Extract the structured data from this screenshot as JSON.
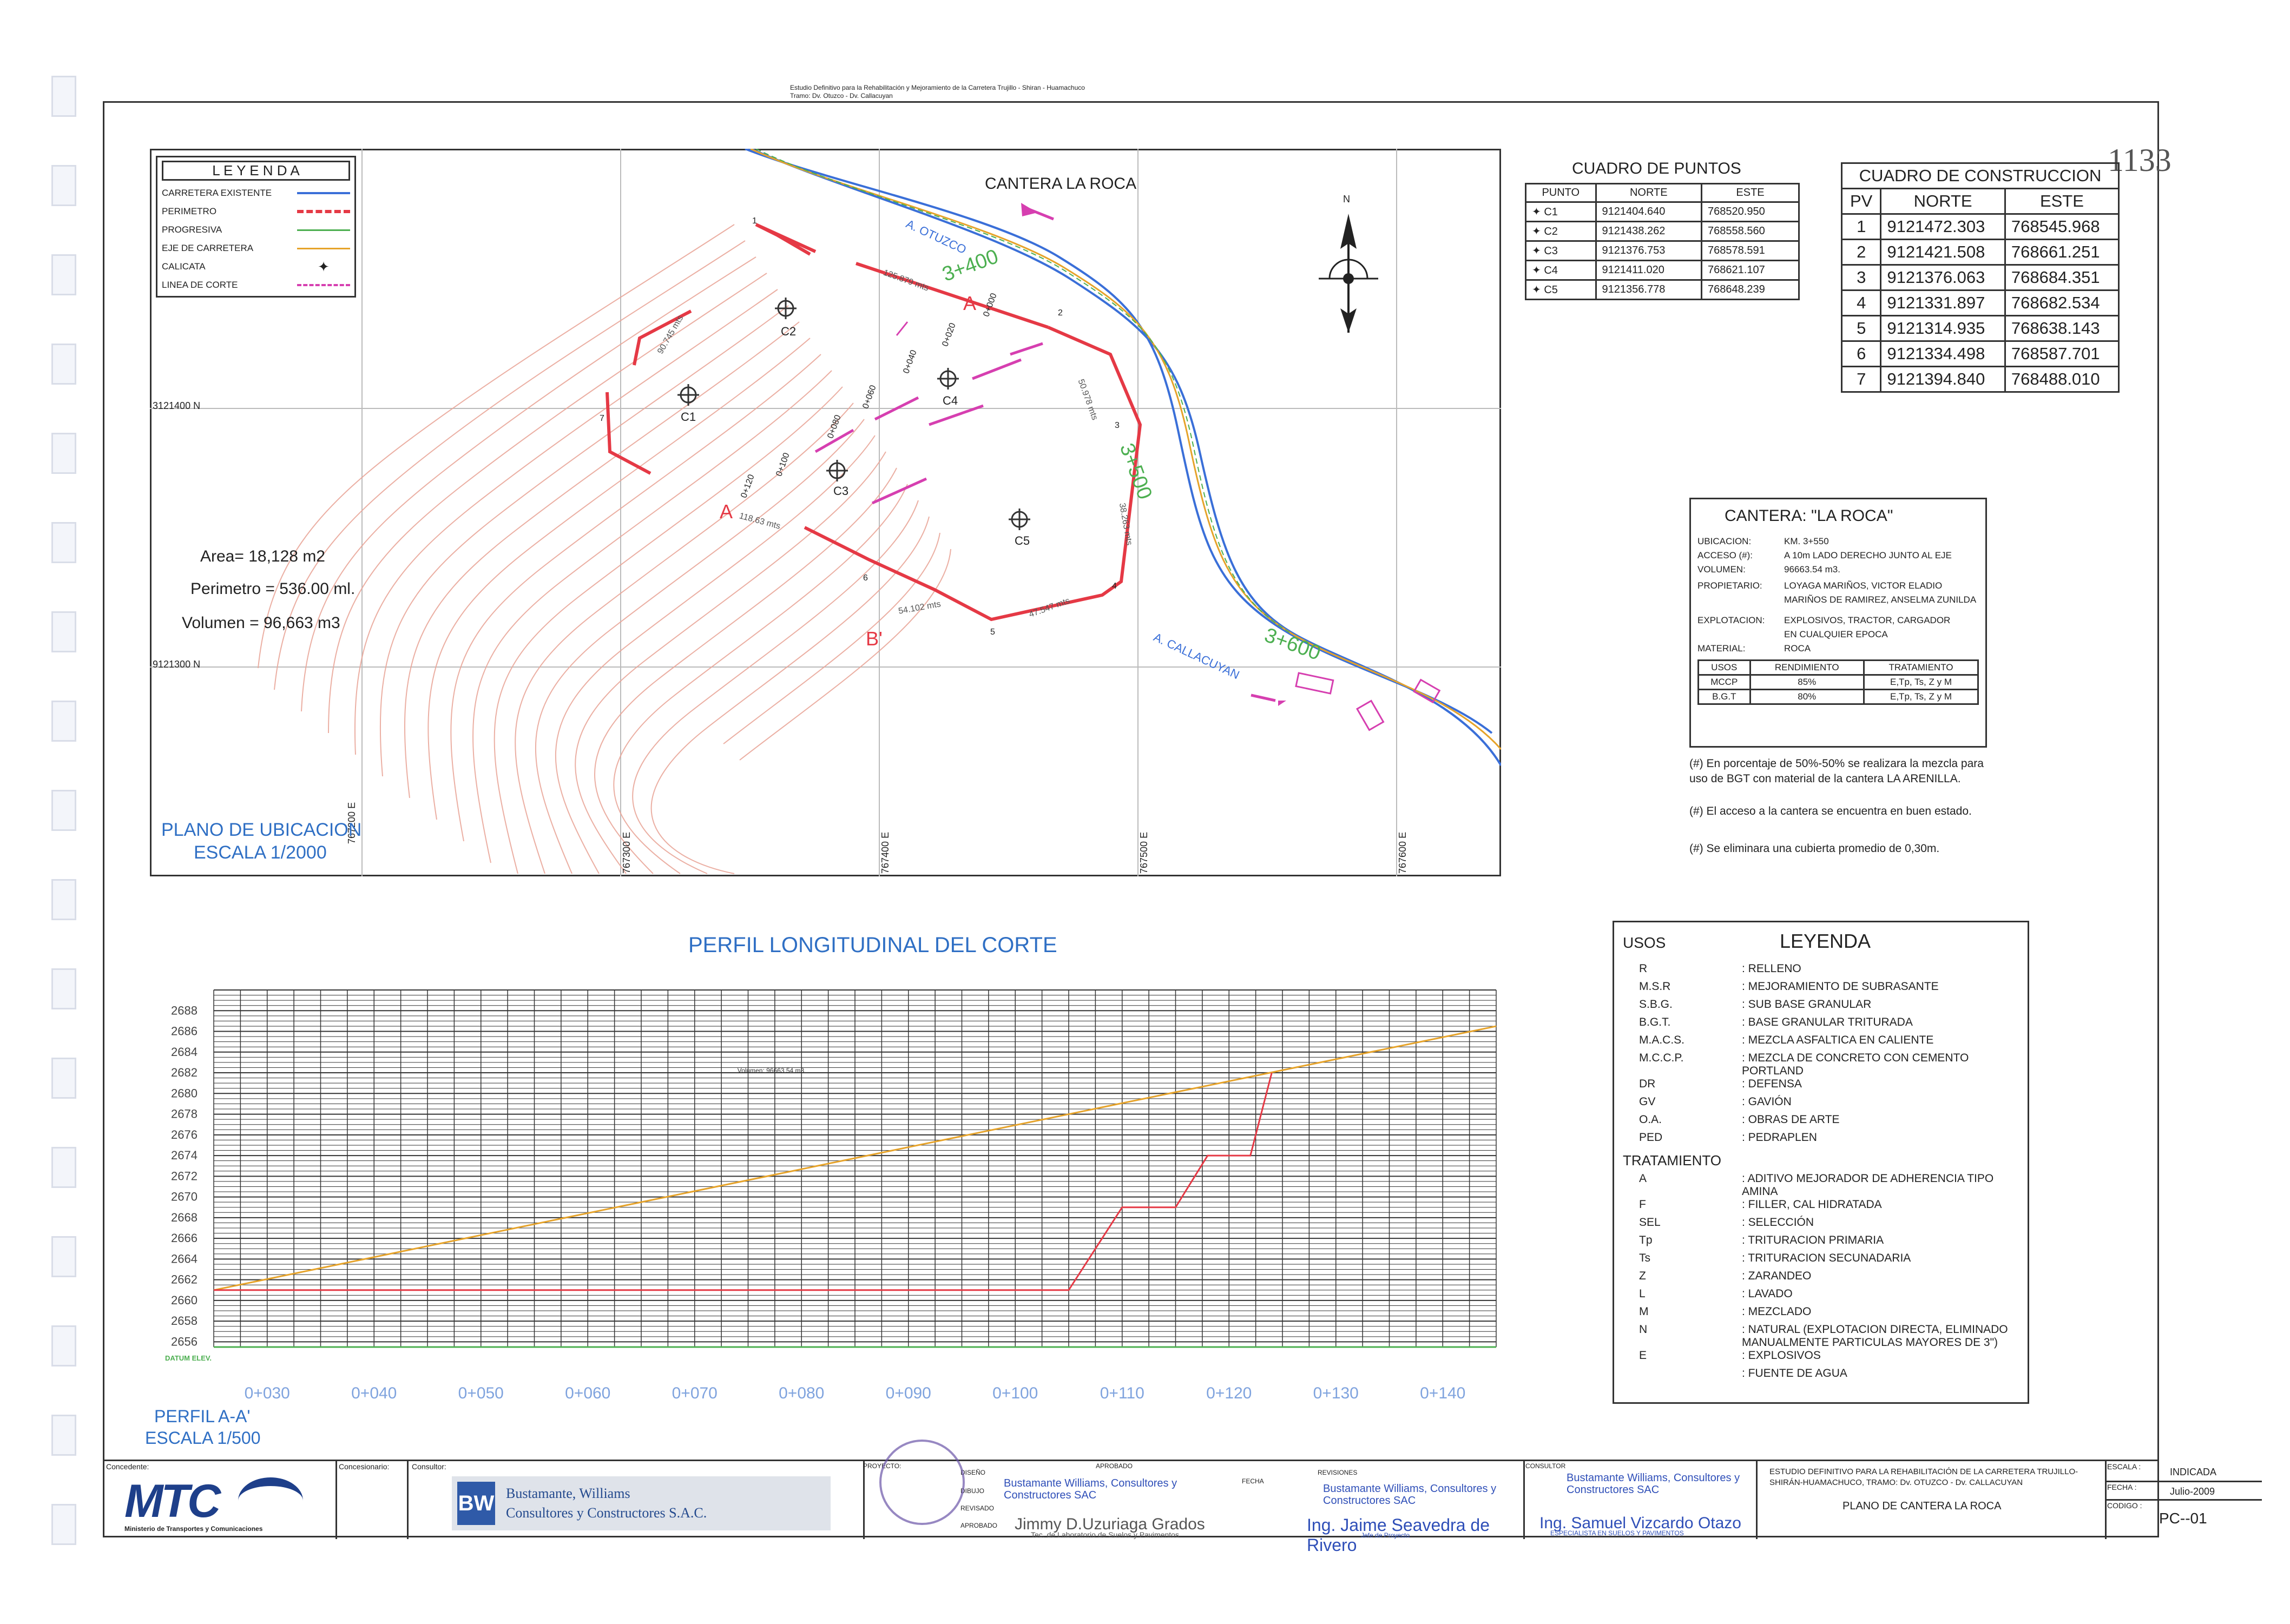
{
  "header": {
    "study_title_top": "Estudio Definitivo para la Rehabilitación y Mejoramiento de la Carretera Trujillo - Shiran - Huamachuco",
    "study_title_sub": "Tramo: Dv. Otuzco - Dv. Callacuyan",
    "sheet_number": "1133"
  },
  "map": {
    "quarry_label": "CANTERA LA ROCA",
    "north_label": "N",
    "grid_north": [
      "3121400 N",
      "9121300 N"
    ],
    "grid_east": [
      "767200 E",
      "767300 E",
      "767400 E",
      "767500 E",
      "767600 E"
    ],
    "stations": [
      "3+400",
      "3+500",
      "3+600"
    ],
    "road_labels": [
      "A. OTUZCO",
      "A. CALLACUYAN"
    ],
    "section_labels": [
      "A",
      "A",
      "B'"
    ],
    "vertex_labels": [
      "1",
      "2",
      "3",
      "4",
      "5",
      "6",
      "7"
    ],
    "calicatas": [
      "C1",
      "C2",
      "C3",
      "C4",
      "C5"
    ],
    "chainage": [
      "0+000",
      "0+020",
      "0+040",
      "0+060",
      "0+080",
      "0+100",
      "0+120"
    ],
    "dims": [
      "125.879 mts",
      "90.745 mts",
      "50.978 mts",
      "118.63 mts",
      "54.102 mts",
      "47.547 mts",
      "38.263 mts"
    ],
    "area": "Area= 18,128 m2",
    "perimetro": "Perimetro = 536.00 ml.",
    "volumen": "Volumen = 96,663 m3",
    "title": "PLANO DE UBICACION",
    "scale": "ESCALA 1/2000"
  },
  "legend_map": {
    "title": "L E Y E N D A",
    "items": [
      {
        "label": "CARRETERA EXISTENTE",
        "color": "#3a6fd8"
      },
      {
        "label": "PERIMETRO",
        "color": "#e53945"
      },
      {
        "label": "PROGRESIVA",
        "color": "#4caf50"
      },
      {
        "label": "EJE DE CARRETERA",
        "color": "#e6a32a"
      },
      {
        "label": "CALICATA",
        "color": "#333333"
      },
      {
        "label": "LINEA DE CORTE",
        "color": "#d63fb0"
      }
    ]
  },
  "cuadro_puntos": {
    "title": "CUADRO DE PUNTOS",
    "headers": [
      "PUNTO",
      "NORTE",
      "ESTE"
    ],
    "rows": [
      [
        "C1",
        "9121404.640",
        "768520.950"
      ],
      [
        "C2",
        "9121438.262",
        "768558.560"
      ],
      [
        "C3",
        "9121376.753",
        "768578.591"
      ],
      [
        "C4",
        "9121411.020",
        "768621.107"
      ],
      [
        "C5",
        "9121356.778",
        "768648.239"
      ]
    ]
  },
  "cuadro_construccion": {
    "title": "CUADRO DE CONSTRUCCION",
    "headers": [
      "PV",
      "NORTE",
      "ESTE"
    ],
    "rows": [
      [
        "1",
        "9121472.303",
        "768545.968"
      ],
      [
        "2",
        "9121421.508",
        "768661.251"
      ],
      [
        "3",
        "9121376.063",
        "768684.351"
      ],
      [
        "4",
        "9121331.897",
        "768682.534"
      ],
      [
        "5",
        "9121314.935",
        "768638.143"
      ],
      [
        "6",
        "9121334.498",
        "768587.701"
      ],
      [
        "7",
        "9121394.840",
        "768488.010"
      ]
    ]
  },
  "cantera": {
    "title": "CANTERA:  \"LA ROCA\"",
    "fields": [
      {
        "k": "UBICACION:",
        "v": "KM. 3+550"
      },
      {
        "k": "ACCESO (#):",
        "v": "A 10m LADO DERECHO JUNTO AL EJE"
      },
      {
        "k": "VOLUMEN:",
        "v": "96663.54 m3."
      },
      {
        "k": "PROPIETARIO:",
        "v": "LOYAGA MARIÑOS, VICTOR ELADIO"
      },
      {
        "k": "",
        "v": "MARIÑOS DE RAMIREZ, ANSELMA ZUNILDA"
      },
      {
        "k": "EXPLOTACION:",
        "v": "EXPLOSIVOS, TRACTOR, CARGADOR"
      },
      {
        "k": "",
        "v": "EN CUALQUIER EPOCA"
      },
      {
        "k": "MATERIAL:",
        "v": "ROCA"
      }
    ],
    "uses_headers": [
      "USOS",
      "RENDIMIENTO",
      "TRATAMIENTO"
    ],
    "uses_rows": [
      [
        "MCCP",
        "85%",
        "E,Tp, Ts, Z y M"
      ],
      [
        "B.G.T",
        "80%",
        "E,Tp, Ts, Z y M"
      ]
    ],
    "notes": [
      "(#)  En porcentaje de 50%-50% se realizara la mezcla para uso de BGT con material de la cantera LA ARENILLA.",
      "(#)  El acceso a la cantera se encuentra en buen estado.",
      "(#)  Se eliminara una cubierta promedio de 0,30m."
    ]
  },
  "profile": {
    "title": "PERFIL LONGITUDINAL DEL CORTE",
    "subtitle": "PERFIL A-A'",
    "scale": "ESCALA 1/500",
    "datum_label": "DATUM ELEV.",
    "volume_tag": "Volumen: 96663.54 m3",
    "chart_data": {
      "type": "line",
      "x_ticks": [
        "0+030",
        "0+040",
        "0+050",
        "0+060",
        "0+070",
        "0+080",
        "0+090",
        "0+100",
        "0+110",
        "0+120",
        "0+130",
        "0+140"
      ],
      "y_ticks": [
        2656,
        2658,
        2660,
        2662,
        2664,
        2666,
        2668,
        2670,
        2672,
        2674,
        2676,
        2678,
        2680,
        2682,
        2684,
        2686,
        2688
      ],
      "ylim": [
        2655.5,
        2690
      ],
      "xlim": [
        25,
        145
      ],
      "series": [
        {
          "color": "#e6a32a",
          "x": [
            25,
            145
          ],
          "y": [
            2661,
            2686.5
          ]
        },
        {
          "color": "#e53945",
          "x": [
            25,
            105,
            110,
            115,
            118,
            122,
            124
          ],
          "y": [
            2661,
            2661,
            2669,
            2669,
            2674,
            2674,
            2682
          ]
        }
      ]
    }
  },
  "legend_usos": {
    "title": "LEYENDA",
    "usos_heading": "USOS",
    "usos": [
      [
        "R",
        ": RELLENO"
      ],
      [
        "M.S.R",
        ": MEJORAMIENTO DE SUBRASANTE"
      ],
      [
        "S.B.G.",
        ": SUB BASE GRANULAR"
      ],
      [
        "B.G.T.",
        ": BASE GRANULAR TRITURADA"
      ],
      [
        "M.A.C.S.",
        ": MEZCLA ASFALTICA EN CALIENTE"
      ],
      [
        "M.C.C.P.",
        ": MEZCLA DE CONCRETO CON CEMENTO PORTLAND"
      ],
      [
        "DR",
        ": DEFENSA"
      ],
      [
        "GV",
        ": GAVIÓN"
      ],
      [
        "O.A.",
        ": OBRAS DE ARTE"
      ],
      [
        "PED",
        ": PEDRAPLEN"
      ]
    ],
    "trat_heading": "TRATAMIENTO",
    "tratamiento": [
      [
        "A",
        ": ADITIVO MEJORADOR DE ADHERENCIA TIPO AMINA"
      ],
      [
        "F",
        ": FILLER, CAL HIDRATADA"
      ],
      [
        "SEL",
        ": SELECCIÓN"
      ],
      [
        "Tp",
        ": TRITURACION PRIMARIA"
      ],
      [
        "Ts",
        ": TRITURACION SECUNADARIA"
      ],
      [
        "Z",
        ": ZARANDEO"
      ],
      [
        "L",
        ": LAVADO"
      ],
      [
        "M",
        ": MEZCLADO"
      ],
      [
        "N",
        ": NATURAL (EXPLOTACION DIRECTA, ELIMINADO MANUALMENTE PARTICULAS MAYORES DE 3\")"
      ],
      [
        "E",
        ": EXPLOSIVOS"
      ],
      [
        "",
        ": FUENTE DE AGUA"
      ]
    ]
  },
  "titleblock": {
    "concedente": "Concedente:",
    "mtc": "MTC",
    "mtc_sub": "Ministerio de Transportes y Comunicaciones",
    "concesionario": "Concesionario:",
    "consultor": "Consultor:",
    "bw_name": "Bustamante, Williams",
    "bw_name2": "Consultores y Constructores S.A.C.",
    "proyecto": "PROYECTO:",
    "diseno": "DISEÑO",
    "dibujo": "DIBUJO",
    "revisado": "REVISADO",
    "aprobado": "APROBADO",
    "revisiones": "REVISIONES",
    "fecha": "FECHA",
    "bw_stamp": "Bustamante Williams, Consultores y Constructores SAC",
    "sig1": "Jimmy D.Uzuriaga Grados",
    "sig1_role": "Tec. de Laboratorio de Suelos y Pavimentos",
    "sig2": "Ing. Jaime Seavedra de Rivero",
    "sig2_role": "Jefe de Proyecto",
    "sig3": "Ing. Samuel Vizcardo Otazo",
    "sig3_role": "ESPECIALISTA EN SUELOS Y PAVIMENTOS",
    "study": "ESTUDIO DEFINITIVO PARA LA REHABILITACIÓN DE LA CARRETERA TRUJILLO-SHIRÁN-HUAMACHUCO, TRAMO: Dv. OTUZCO - Dv. CALLACUYAN",
    "plano": "PLANO DE CANTERA LA ROCA",
    "escala_lbl": "ESCALA :",
    "escala_val": "INDICADA",
    "fecha_lbl": "FECHA :",
    "fecha_val": "Julio-2009",
    "codigo_lbl": "CODIGO :",
    "codigo_val": "PC--01"
  }
}
